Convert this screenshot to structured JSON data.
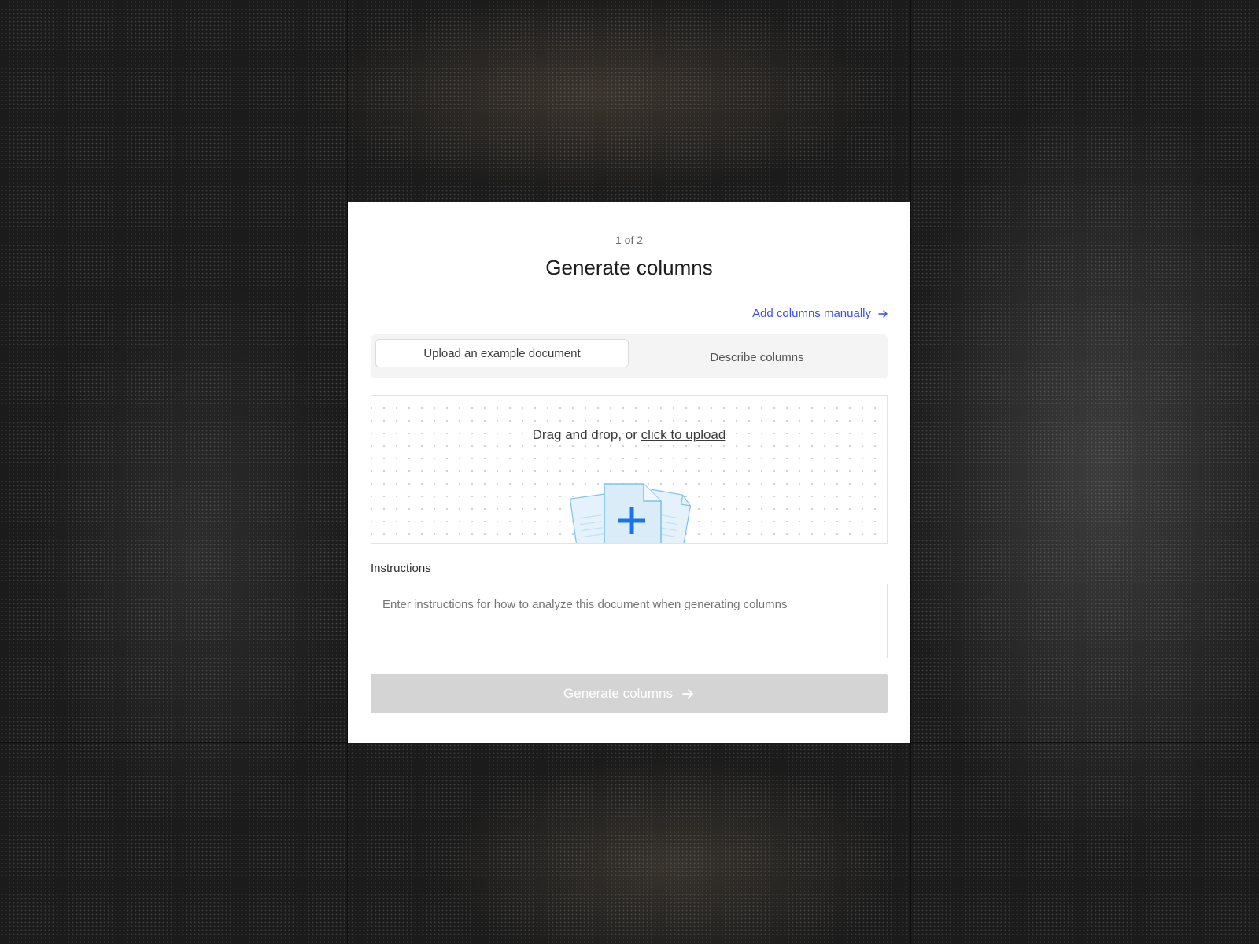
{
  "modal": {
    "step_indicator": "1 of 2",
    "title": "Generate columns",
    "manual_link_label": "Add columns manually",
    "tabs": [
      {
        "label": "Upload an example document",
        "active": true
      },
      {
        "label": "Describe columns",
        "active": false
      }
    ],
    "dropzone": {
      "prefix": "Drag and drop, or ",
      "link_label": "click to upload",
      "icon": "document-add-icon"
    },
    "instructions": {
      "label": "Instructions",
      "value": "",
      "placeholder": "Enter instructions for how to analyze this document when generating columns"
    },
    "submit_label": "Generate columns",
    "submit_disabled": true
  },
  "colors": {
    "link": "#3a4ff0",
    "icon_blue": "#1a73e8",
    "disabled_button": "#d4d4d4"
  }
}
